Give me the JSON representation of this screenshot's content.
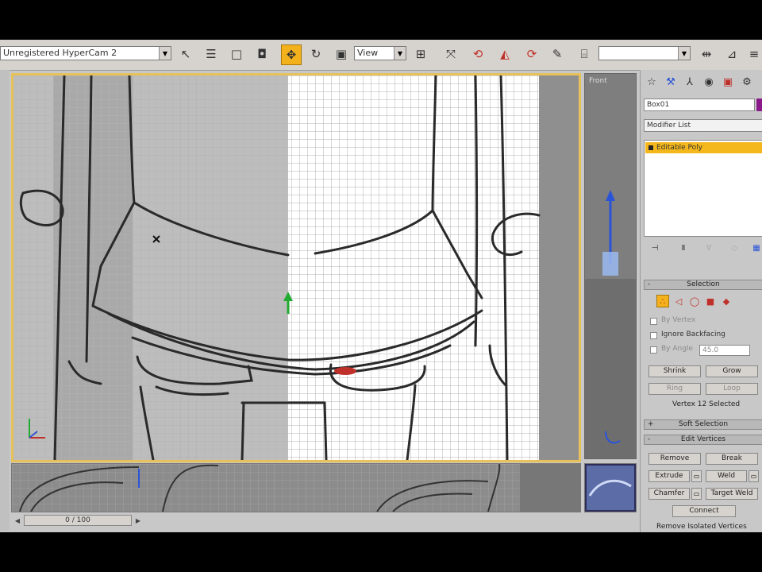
{
  "toolbar": {
    "title_combo": "Unregistered HyperCam 2",
    "reference_coord": "View",
    "named_selection": "",
    "icons": [
      "select-arrow-icon",
      "select-by-name-icon",
      "rect-region-icon",
      "window-crossing-icon",
      "move-icon",
      "rotate-icon",
      "scale-icon",
      "view-combo",
      "pivot-icon",
      "snap-icon",
      "angle-snap-icon",
      "percent-snap-icon",
      "spinner-snap-icon",
      "edit-named-icon",
      "named-selection-combo",
      "mirror-icon",
      "align-icon",
      "layer-icon"
    ]
  },
  "viewport": {
    "main_label": "",
    "right_label": "Front"
  },
  "timeline": {
    "position_text": "0 / 100"
  },
  "command_panel": {
    "object_name": "Box01",
    "modifier_list": "Modifier List",
    "stack_item": "Editable Poly",
    "selection_title": "Selection",
    "by_vertex": "By Vertex",
    "ignore_backfacing": "Ignore Backfacing",
    "by_angle": "By Angle",
    "angle_value": "45.0",
    "shrink": "Shrink",
    "grow": "Grow",
    "ring": "Ring",
    "loop": "Loop",
    "status": "Vertex 12 Selected",
    "soft_selection": "Soft Selection",
    "edit_vertices": "Edit Vertices",
    "remove": "Remove",
    "break": "Break",
    "extrude": "Extrude",
    "weld": "Weld",
    "chamfer": "Chamfer",
    "target_weld": "Target Weld",
    "connect": "Connect",
    "remove_isolated": "Remove Isolated Vertices"
  },
  "colors": {
    "active_tool": "#f3b21b",
    "viewport_border": "#e7c25a",
    "stack_highlight": "#f5b81c"
  }
}
